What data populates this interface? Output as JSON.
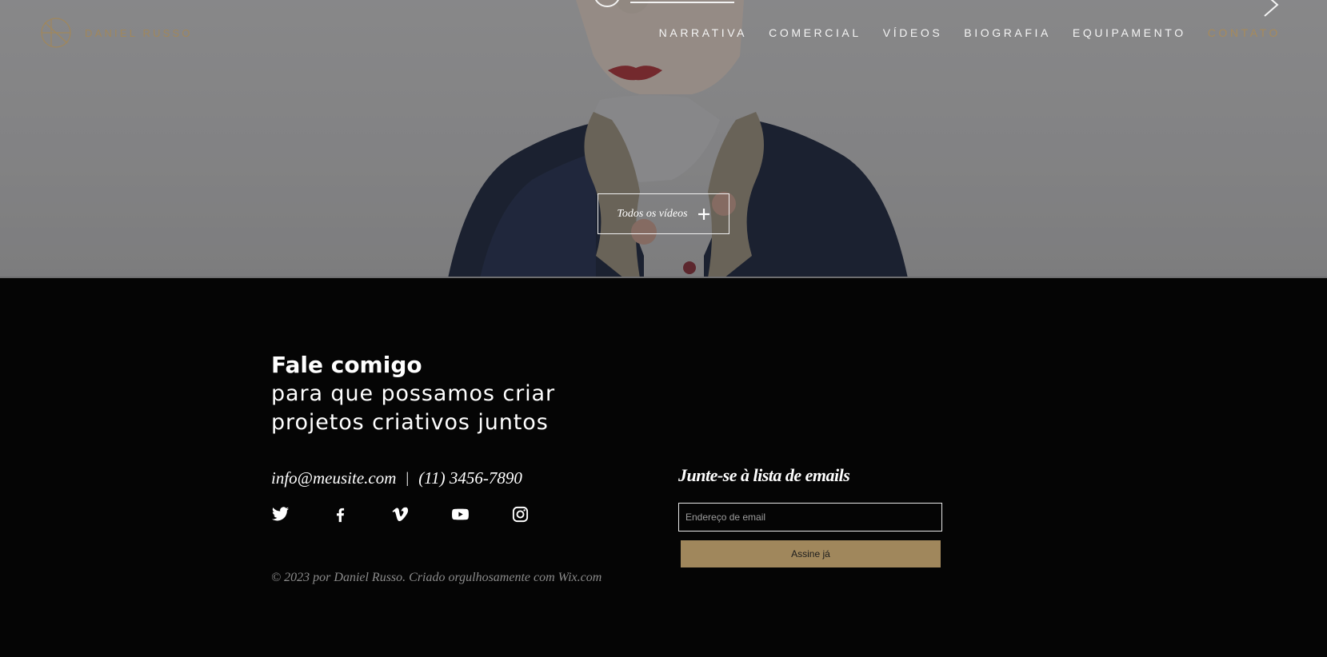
{
  "header": {
    "logo_text": "DANIEL RUSSO",
    "nav": [
      {
        "label": "NARRATIVA"
      },
      {
        "label": "COMERCIAL"
      },
      {
        "label": "VÍDEOS"
      },
      {
        "label": "BIOGRAFIA"
      },
      {
        "label": "EQUIPAMENTO"
      },
      {
        "label": "CONTATO",
        "active": true
      }
    ]
  },
  "hero": {
    "all_videos_label": "Todos os vídeos"
  },
  "footer": {
    "headline_bold": "Fale comigo",
    "headline_line1": "para que possamos criar",
    "headline_line2": "projetos criativos juntos",
    "email": "info@meusite.com",
    "separator": "|",
    "phone": "(11) 3456-7890",
    "socials": [
      "twitter-icon",
      "facebook-icon",
      "vimeo-icon",
      "youtube-icon",
      "instagram-icon"
    ],
    "copyright": "© 2023 por Daniel Russo. Criado orgulhosamente com Wix.com",
    "newsletter": {
      "title": "Junte-se à lista de emails",
      "placeholder": "Endereço de email",
      "button": "Assine já"
    }
  },
  "colors": {
    "accent_gold": "#a0875c",
    "background": "#050505",
    "text": "#ffffff",
    "muted": "#8a8a8a"
  }
}
